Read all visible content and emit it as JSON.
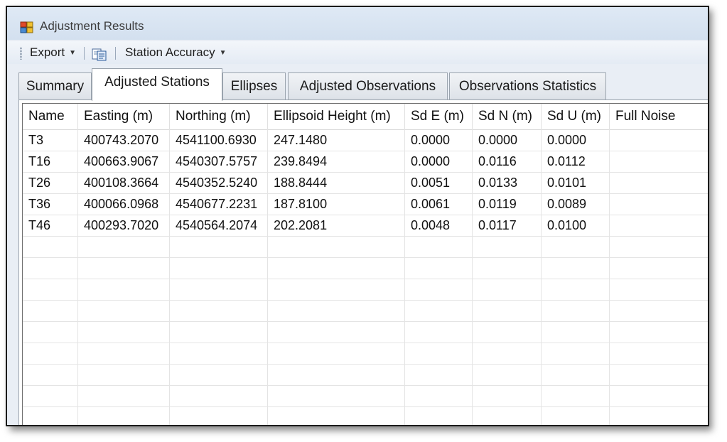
{
  "window": {
    "title": "Adjustment Results"
  },
  "toolbar": {
    "export_label": "Export",
    "copy_icon": "copy-icon",
    "station_accuracy_label": "Station Accuracy"
  },
  "tabs": [
    {
      "label": "Summary",
      "active": false
    },
    {
      "label": "Adjusted Stations",
      "active": true
    },
    {
      "label": "Ellipses",
      "active": false
    },
    {
      "label": "Adjusted Observations",
      "active": false
    },
    {
      "label": "Observations Statistics",
      "active": false
    }
  ],
  "table": {
    "columns": [
      "Name",
      "Easting (m)",
      "Northing (m)",
      "Ellipsoid Height (m)",
      "Sd E (m)",
      "Sd N (m)",
      "Sd U (m)",
      "Full Noise"
    ],
    "rows": [
      [
        "T3",
        "400743.2070",
        "4541100.6930",
        "247.1480",
        "0.0000",
        "0.0000",
        "0.0000",
        ""
      ],
      [
        "T16",
        "400663.9067",
        "4540307.5757",
        "239.8494",
        "0.0000",
        "0.0116",
        "0.0112",
        ""
      ],
      [
        "T26",
        "400108.3664",
        "4540352.5240",
        "188.8444",
        "0.0051",
        "0.0133",
        "0.0101",
        ""
      ],
      [
        "T36",
        "400066.0968",
        "4540677.2231",
        "187.8100",
        "0.0061",
        "0.0119",
        "0.0089",
        ""
      ],
      [
        "T46",
        "400293.7020",
        "4540564.2074",
        "202.2081",
        "0.0048",
        "0.0117",
        "0.0100",
        ""
      ]
    ],
    "empty_rows": 9
  },
  "colors": {
    "title_bg": "#d3e0ef",
    "grid_line": "#e4e4e4",
    "tab_border": "#9aa3ad"
  }
}
